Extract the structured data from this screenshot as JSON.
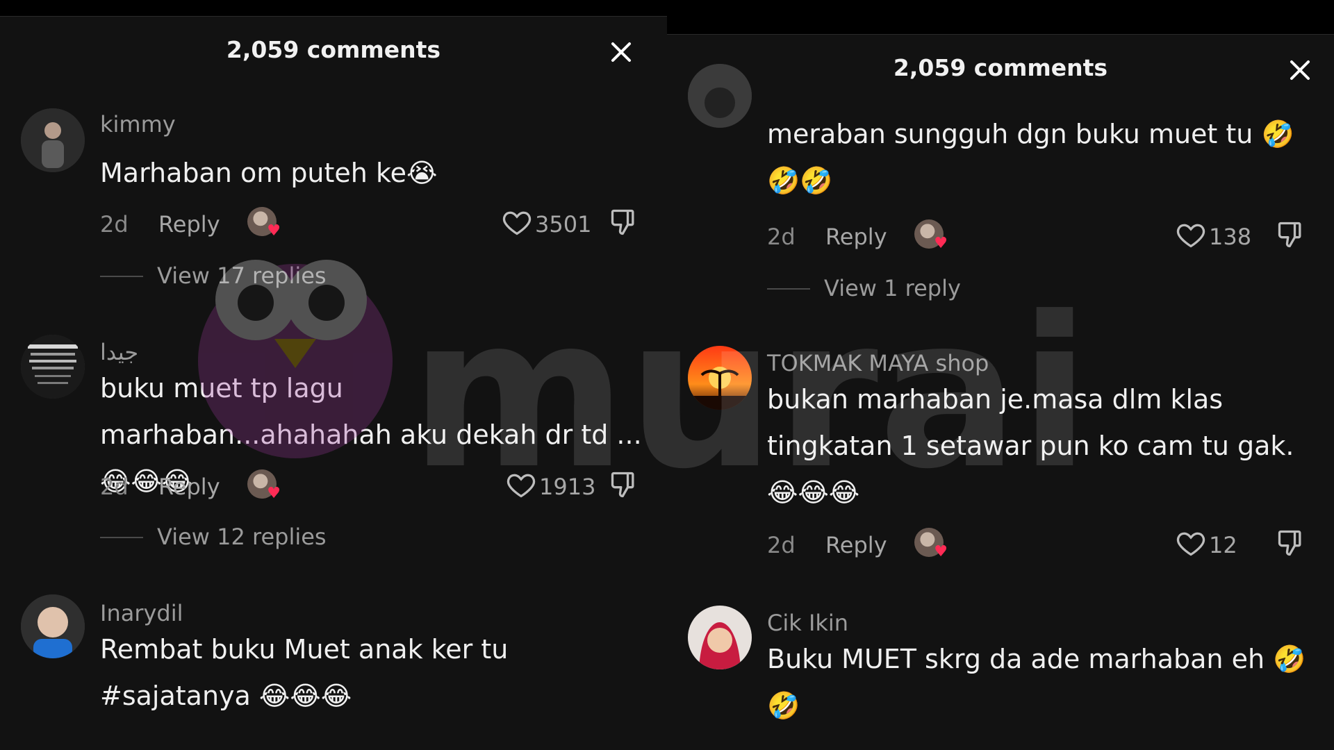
{
  "left": {
    "title": "2,059 comments",
    "comments": [
      {
        "username": "kimmy",
        "text": "Marhaban om puteh ke😭",
        "age": "2d",
        "reply_label": "Reply",
        "likes": "3501",
        "view_replies": "View 17 replies"
      },
      {
        "username": "جيدا",
        "text": "buku muet tp lagu marhaban...ahahahah aku dekah dr td ...😂😂😂",
        "age": "2d",
        "reply_label": "Reply",
        "likes": "1913",
        "view_replies": "View 12 replies"
      },
      {
        "username": "Inarydil",
        "text": "Rembat buku Muet anak ker tu #sajatanya 😂😂😂"
      }
    ]
  },
  "right": {
    "title": "2,059 comments",
    "comments": [
      {
        "text": "meraban sungguh dgn buku muet tu 🤣🤣🤣",
        "age": "2d",
        "reply_label": "Reply",
        "likes": "138",
        "view_replies": "View 1 reply"
      },
      {
        "username": "TOKMAK MAYA shop",
        "text": "bukan marhaban je.masa dlm klas tingkatan 1 setawar pun ko cam tu gak.😂😂😂",
        "age": "2d",
        "reply_label": "Reply",
        "likes": "12"
      },
      {
        "username": "Cik Ikin",
        "text": "Buku MUET skrg da ade marhaban eh 🤣🤣"
      }
    ]
  },
  "watermark": {
    "text": "murai"
  },
  "icons": {
    "close": "close-icon",
    "like": "heart-outline-icon",
    "dislike": "thumbs-down-icon",
    "creator_liked": "creator-heart-badge-icon"
  },
  "colors": {
    "background": "#121212",
    "like_badge": "#ff2b55"
  }
}
